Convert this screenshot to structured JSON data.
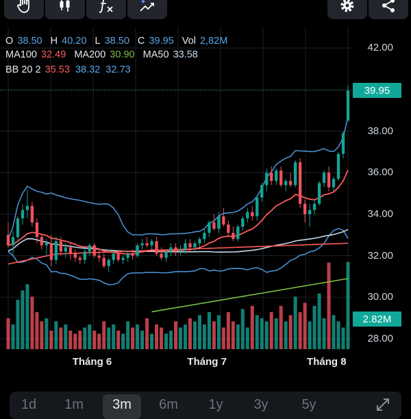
{
  "toolbar": {
    "icons": [
      "hand-icon",
      "candlestick-icon",
      "function-icon",
      "magic-trend-icon"
    ],
    "right_icons": [
      "gear-icon",
      "share-icon"
    ]
  },
  "legend": {
    "o_label": "O",
    "o_value": "38.50",
    "h_label": "H",
    "h_value": "40.20",
    "l_label": "L",
    "l_value": "38.50",
    "c_label": "C",
    "c_value": "39.95",
    "vol_label": "Vol",
    "vol_value": "2,82M",
    "ma100_label": "MA100",
    "ma100_value": "32.49",
    "ma200_label": "MA200",
    "ma200_value": "30.90",
    "ma50_label": "MA50",
    "ma50_value": "33.58",
    "bb_label": "BB 20 2",
    "bb_upper": "35.53",
    "bb_mid": "38.32",
    "bb_lower": "32.73"
  },
  "price_badge": "39.95",
  "volume_badge": "2.82M",
  "range_tabs": [
    "1d",
    "1m",
    "3m",
    "6m",
    "1y",
    "3y",
    "5y"
  ],
  "selected_range": "3m",
  "colors": {
    "up": "#16a394",
    "down": "#f0515d",
    "ma100": "#ff5c5c",
    "ma200": "#7cc142",
    "ma50": "#c7d9ee",
    "bb": "#4a8fd0",
    "badge": "#11a89a",
    "label_open": "#58a6e8",
    "vol_value": "#58a6e8"
  },
  "chart_data": {
    "type": "candlestick",
    "y_ticks": [
      "42.00",
      "40.00",
      "38.00",
      "36.00",
      "34.00",
      "32.00",
      "30.00",
      "28.00"
    ],
    "ylim": [
      27.5,
      42.5
    ],
    "x_labels": [
      "Tháng 6",
      "Tháng 7",
      "Tháng 8"
    ],
    "x_label_index": [
      18,
      42,
      67
    ],
    "last_close": 39.95,
    "candles": [
      [
        33.0,
        33.6,
        32.4,
        32.5
      ],
      [
        32.5,
        33.2,
        32.0,
        32.9
      ],
      [
        32.9,
        33.9,
        32.7,
        33.8
      ],
      [
        33.8,
        34.5,
        33.5,
        34.2
      ],
      [
        34.2,
        35.2,
        33.8,
        34.4
      ],
      [
        34.4,
        34.6,
        33.4,
        33.6
      ],
      [
        33.6,
        33.8,
        32.6,
        32.9
      ],
      [
        32.9,
        33.0,
        32.3,
        32.5
      ],
      [
        32.5,
        32.8,
        32.0,
        32.6
      ],
      [
        32.6,
        33.0,
        31.5,
        31.8
      ],
      [
        31.8,
        32.9,
        31.6,
        32.7
      ],
      [
        32.7,
        32.9,
        32.0,
        32.2
      ],
      [
        32.2,
        32.6,
        31.9,
        32.4
      ],
      [
        32.4,
        32.6,
        31.8,
        32.1
      ],
      [
        32.1,
        32.3,
        31.7,
        31.9
      ],
      [
        31.9,
        32.0,
        31.6,
        31.8
      ],
      [
        31.8,
        32.3,
        31.6,
        32.2
      ],
      [
        32.2,
        32.6,
        32.0,
        32.5
      ],
      [
        32.5,
        32.6,
        31.9,
        32.0
      ],
      [
        32.0,
        32.3,
        31.7,
        31.9
      ],
      [
        31.9,
        32.1,
        31.4,
        31.5
      ],
      [
        31.5,
        31.9,
        31.2,
        31.8
      ],
      [
        31.8,
        32.2,
        31.6,
        32.1
      ],
      [
        32.1,
        32.3,
        31.7,
        31.8
      ],
      [
        31.8,
        32.0,
        31.6,
        31.9
      ],
      [
        31.9,
        32.2,
        31.7,
        32.1
      ],
      [
        32.1,
        32.3,
        31.8,
        32.0
      ],
      [
        32.0,
        32.6,
        31.9,
        32.5
      ],
      [
        32.5,
        32.8,
        32.3,
        32.6
      ],
      [
        32.6,
        32.9,
        32.4,
        32.5
      ],
      [
        32.5,
        32.8,
        32.3,
        32.7
      ],
      [
        32.7,
        32.9,
        32.0,
        32.1
      ],
      [
        32.1,
        32.4,
        31.8,
        31.9
      ],
      [
        31.9,
        32.3,
        31.7,
        32.2
      ],
      [
        32.2,
        32.6,
        32.0,
        32.4
      ],
      [
        32.4,
        32.6,
        32.0,
        32.2
      ],
      [
        32.2,
        32.5,
        32.0,
        32.3
      ],
      [
        32.3,
        32.8,
        32.1,
        32.6
      ],
      [
        32.6,
        32.8,
        32.2,
        32.4
      ],
      [
        32.4,
        32.7,
        32.2,
        32.6
      ],
      [
        32.6,
        32.9,
        32.4,
        32.8
      ],
      [
        32.8,
        33.3,
        32.6,
        33.1
      ],
      [
        33.1,
        33.7,
        32.9,
        33.6
      ],
      [
        33.6,
        34.0,
        33.2,
        33.3
      ],
      [
        33.3,
        34.1,
        33.1,
        33.9
      ],
      [
        33.9,
        34.3,
        33.4,
        33.5
      ],
      [
        33.5,
        33.7,
        32.9,
        33.1
      ],
      [
        33.1,
        33.4,
        32.7,
        32.8
      ],
      [
        32.8,
        33.5,
        32.7,
        33.4
      ],
      [
        33.4,
        33.9,
        33.2,
        33.8
      ],
      [
        33.8,
        34.3,
        33.6,
        34.1
      ],
      [
        34.1,
        34.4,
        33.7,
        33.9
      ],
      [
        33.9,
        34.9,
        33.7,
        34.8
      ],
      [
        34.8,
        35.5,
        34.6,
        35.4
      ],
      [
        35.4,
        36.2,
        35.1,
        36.0
      ],
      [
        36.0,
        36.3,
        35.4,
        35.6
      ],
      [
        35.6,
        36.2,
        35.4,
        36.1
      ],
      [
        36.1,
        36.3,
        35.3,
        35.4
      ],
      [
        35.4,
        35.7,
        35.1,
        35.6
      ],
      [
        35.6,
        36.0,
        35.3,
        35.4
      ],
      [
        35.4,
        36.6,
        35.3,
        36.5
      ],
      [
        36.5,
        36.7,
        34.3,
        34.5
      ],
      [
        34.5,
        34.7,
        33.6,
        34.0
      ],
      [
        34.0,
        34.5,
        33.4,
        34.2
      ],
      [
        34.2,
        34.7,
        34.0,
        34.5
      ],
      [
        34.5,
        35.6,
        34.4,
        35.5
      ],
      [
        35.5,
        36.1,
        35.3,
        36.0
      ],
      [
        36.0,
        36.3,
        35.1,
        35.3
      ],
      [
        35.3,
        35.8,
        35.1,
        35.7
      ],
      [
        35.7,
        37.0,
        35.6,
        36.9
      ],
      [
        36.9,
        38.0,
        36.7,
        37.9
      ],
      [
        38.5,
        40.2,
        38.5,
        39.95
      ]
    ],
    "volume_ylim": [
      0,
      3.1
    ],
    "volume": [
      1.0,
      0.8,
      1.6,
      1.9,
      2.1,
      1.7,
      1.2,
      0.9,
      1.0,
      0.6,
      0.9,
      0.7,
      0.8,
      0.6,
      0.5,
      0.6,
      0.7,
      0.8,
      0.6,
      0.5,
      0.9,
      0.7,
      0.8,
      0.6,
      0.5,
      0.9,
      0.7,
      0.8,
      0.6,
      1.0,
      0.5,
      0.8,
      0.7,
      0.5,
      0.6,
      0.9,
      0.7,
      0.8,
      1.0,
      0.9,
      1.1,
      0.8,
      1.2,
      0.9,
      1.1,
      0.7,
      1.2,
      0.9,
      0.8,
      1.3,
      0.7,
      1.4,
      1.1,
      1.0,
      0.9,
      1.2,
      1.0,
      1.4,
      0.9,
      1.1,
      1.7,
      1.2,
      1.5,
      0.9,
      1.4,
      1.8,
      1.0,
      2.8,
      1.1,
      0.9,
      0.7,
      2.82
    ]
  }
}
